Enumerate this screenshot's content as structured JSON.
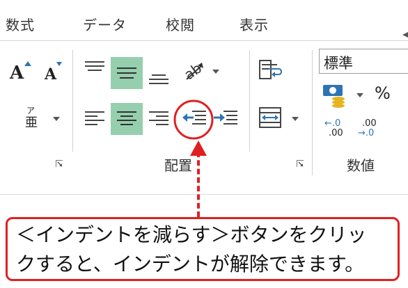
{
  "tabs": [
    "数式",
    "データ",
    "校閲",
    "表示"
  ],
  "font_group": {
    "increase_font_label": "A",
    "decrease_font_label": "A",
    "phonetic_label": "亜",
    "phonetic_ruby": "ア"
  },
  "alignment_group": {
    "label": "配置"
  },
  "number_group": {
    "label": "数値",
    "format_value": "標準",
    "percent_label": "%",
    "increase_decimal_top": "←.0",
    "increase_decimal_bottom": ".00",
    "decrease_decimal_top": ".00",
    "decrease_decimal_bottom": "→.0"
  },
  "callout": {
    "line1": "＜インデントを減らす＞ボタンをクリッ",
    "line2": "クすると、インデントが解除できます。",
    "color": "#e02020"
  },
  "colors": {
    "active_highlight": "#95cfae",
    "icon_blue": "#2e74b5"
  }
}
